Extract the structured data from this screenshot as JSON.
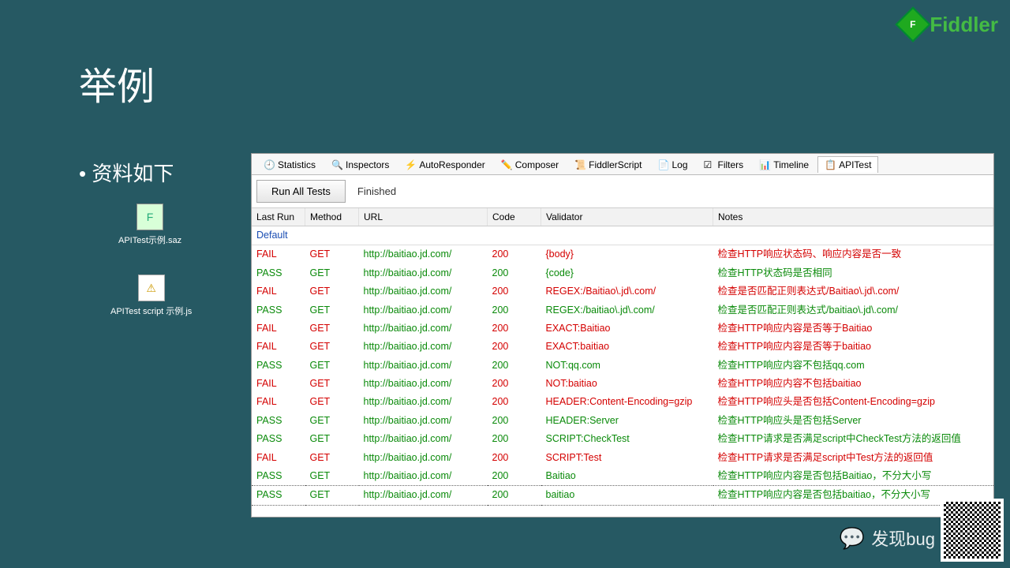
{
  "slide": {
    "title": "举例",
    "bullet": "资料如下"
  },
  "brand": {
    "name": "Fiddler",
    "letter": "F"
  },
  "files": {
    "f1": "APITest示例.saz",
    "f2": "APITest script 示例.js"
  },
  "tabs": [
    {
      "id": "statistics",
      "label": "Statistics"
    },
    {
      "id": "inspectors",
      "label": "Inspectors"
    },
    {
      "id": "autoresponder",
      "label": "AutoResponder"
    },
    {
      "id": "composer",
      "label": "Composer"
    },
    {
      "id": "fiddlerscript",
      "label": "FiddlerScript"
    },
    {
      "id": "log",
      "label": "Log"
    },
    {
      "id": "filters",
      "label": "Filters"
    },
    {
      "id": "timeline",
      "label": "Timeline"
    },
    {
      "id": "apitest",
      "label": "APITest",
      "active": true
    }
  ],
  "toolbar": {
    "run_button": "Run All Tests",
    "status": "Finished"
  },
  "columns": {
    "last_run": "Last Run",
    "method": "Method",
    "url": "URL",
    "code": "Code",
    "validator": "Validator",
    "notes": "Notes"
  },
  "group": "Default",
  "rows": [
    {
      "r": "FAIL",
      "m": "GET",
      "u": "http://baitiao.jd.com/",
      "c": "200",
      "v": "{body}",
      "n": "检查HTTP响应状态码、响应内容是否一致"
    },
    {
      "r": "PASS",
      "m": "GET",
      "u": "http://baitiao.jd.com/",
      "c": "200",
      "v": "{code}",
      "n": "检查HTTP状态码是否相同"
    },
    {
      "r": "FAIL",
      "m": "GET",
      "u": "http://baitiao.jd.com/",
      "c": "200",
      "v": "REGEX:/Baitiao\\.jd\\.com/",
      "n": "检查是否匹配正则表达式/Baitiao\\.jd\\.com/"
    },
    {
      "r": "PASS",
      "m": "GET",
      "u": "http://baitiao.jd.com/",
      "c": "200",
      "v": "REGEX:/baitiao\\.jd\\.com/",
      "n": "检查是否匹配正则表达式/baitiao\\.jd\\.com/"
    },
    {
      "r": "FAIL",
      "m": "GET",
      "u": "http://baitiao.jd.com/",
      "c": "200",
      "v": "EXACT:Baitiao",
      "n": "检查HTTP响应内容是否等于Baitiao"
    },
    {
      "r": "FAIL",
      "m": "GET",
      "u": "http://baitiao.jd.com/",
      "c": "200",
      "v": "EXACT:baitiao",
      "n": "检查HTTP响应内容是否等于baitiao"
    },
    {
      "r": "PASS",
      "m": "GET",
      "u": "http://baitiao.jd.com/",
      "c": "200",
      "v": "NOT:qq.com",
      "n": "检查HTTP响应内容不包括qq.com"
    },
    {
      "r": "FAIL",
      "m": "GET",
      "u": "http://baitiao.jd.com/",
      "c": "200",
      "v": "NOT:baitiao",
      "n": "检查HTTP响应内容不包括baitiao"
    },
    {
      "r": "FAIL",
      "m": "GET",
      "u": "http://baitiao.jd.com/",
      "c": "200",
      "v": "HEADER:Content-Encoding=gzip",
      "n": "检查HTTP响应头是否包括Content-Encoding=gzip"
    },
    {
      "r": "PASS",
      "m": "GET",
      "u": "http://baitiao.jd.com/",
      "c": "200",
      "v": "HEADER:Server",
      "n": "检查HTTP响应头是否包括Server"
    },
    {
      "r": "PASS",
      "m": "GET",
      "u": "http://baitiao.jd.com/",
      "c": "200",
      "v": "SCRIPT:CheckTest",
      "n": "检查HTTP请求是否满足script中CheckTest方法的返回值"
    },
    {
      "r": "FAIL",
      "m": "GET",
      "u": "http://baitiao.jd.com/",
      "c": "200",
      "v": "SCRIPT:Test",
      "n": "检查HTTP请求是否满足script中Test方法的返回值"
    },
    {
      "r": "PASS",
      "m": "GET",
      "u": "http://baitiao.jd.com/",
      "c": "200",
      "v": "Baitiao",
      "n": "检查HTTP响应内容是否包括Baitiao，不分大小写"
    },
    {
      "r": "PASS",
      "m": "GET",
      "u": "http://baitiao.jd.com/",
      "c": "200",
      "v": "baitiao",
      "n": "检查HTTP响应内容是否包括baitiao，不分大小写",
      "sel": true
    }
  ],
  "watermark": "发现bug"
}
